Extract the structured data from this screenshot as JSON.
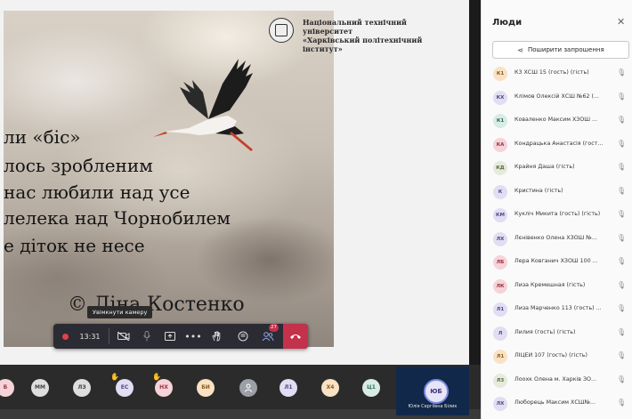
{
  "slide": {
    "poem_lines": [
      "ли «біс»",
      "лось зробленим",
      "нас любили над усе",
      "лелека над Чорнобилем",
      "е діток не несе"
    ],
    "author": "© Ліна Костенко",
    "university_line1": "Національний технічний університет",
    "university_line2": "«Харківський політехнічний інститут»"
  },
  "controls": {
    "timer": "13:31",
    "camera_tooltip": "Увімкнути камеру",
    "more_label": "•••",
    "participants_badge": "27"
  },
  "people_panel": {
    "title": "Люди",
    "share_label": "Поширити запрошення",
    "participants": [
      {
        "initials": "К1",
        "name": "К3 ХСШ 15 (гость) (гість)",
        "bg": "#f9e1c4",
        "fg": "#8a5a1c"
      },
      {
        "initials": "КХ",
        "name": "Клімов Олексій ХСШ №62 (...",
        "bg": "#e1ddf2",
        "fg": "#4f4a85"
      },
      {
        "initials": "К1",
        "name": "Коваленко Максим ХЗОШ ...",
        "bg": "#d7ece4",
        "fg": "#2f6d55"
      },
      {
        "initials": "КА",
        "name": "Кондрацька Анастасія (гост...",
        "bg": "#f5d3d8",
        "fg": "#9a3144"
      },
      {
        "initials": "КД",
        "name": "Крайня Даша (гість)",
        "bg": "#e6eadc",
        "fg": "#5a6a3a"
      },
      {
        "initials": "К",
        "name": "Кристина (гість)",
        "bg": "#e1ddf2",
        "fg": "#4f4a85"
      },
      {
        "initials": "КМ",
        "name": "Кукліч Микита (гость) (гість)",
        "bg": "#e1ddf2",
        "fg": "#4f4a85"
      },
      {
        "initials": "ЛХ",
        "name": "Лєнівенко Олена ХЗОШ №...",
        "bg": "#e1ddf2",
        "fg": "#4f4a85"
      },
      {
        "initials": "ЛБ",
        "name": "Лера Ковганич ХЗОШ 100 ...",
        "bg": "#f5d3d8",
        "fg": "#9a3144"
      },
      {
        "initials": "ЛК",
        "name": "Лиза Кремешная (гість)",
        "bg": "#f5d3d8",
        "fg": "#9a3144"
      },
      {
        "initials": "Л1",
        "name": "Лиза Марченко 113 (гость) ...",
        "bg": "#e1ddf2",
        "fg": "#4f4a85"
      },
      {
        "initials": "Л",
        "name": "Лилия (гость) (гість)",
        "bg": "#e1ddf2",
        "fg": "#4f4a85"
      },
      {
        "initials": "Л1",
        "name": "ЛІЦЕЙ 107 (гость) (гість)",
        "bg": "#f9e1c4",
        "fg": "#8a5a1c"
      },
      {
        "initials": "Л3",
        "name": "Лоохк Олена м. Харків ЗО...",
        "bg": "#e6eadc",
        "fg": "#5a6a3a"
      },
      {
        "initials": "ЛХ",
        "name": "Люборець Максим ХСШ№...",
        "bg": "#e1ddf2",
        "fg": "#4f4a85"
      }
    ]
  },
  "bottom_bar": {
    "avatars": [
      {
        "initials": "Б",
        "bg": "#f5d3d8",
        "fg": "#9a3144"
      },
      {
        "initials": "ММ",
        "bg": "#dedede",
        "fg": "#444444"
      },
      {
        "initials": "ЛЗ",
        "bg": "#dedede",
        "fg": "#444444"
      },
      {
        "initials": "ЕС",
        "bg": "#e1ddf2",
        "fg": "#4f4a85"
      },
      {
        "initials": "НХ",
        "bg": "#f5d3d8",
        "fg": "#9a3144"
      },
      {
        "initials": "БИ",
        "bg": "#f9e1c4",
        "fg": "#8a5a1c"
      },
      {
        "initials": "",
        "bg": "#9aa0a6",
        "fg": "#ffffff"
      },
      {
        "initials": "Л1",
        "bg": "#e1ddf2",
        "fg": "#4f4a85"
      },
      {
        "initials": "Х4",
        "bg": "#f9e1c4",
        "fg": "#8a5a1c"
      },
      {
        "initials": "Ц1",
        "bg": "#d7ece4",
        "fg": "#2f6d55"
      }
    ],
    "speaker": {
      "initials": "ЮБ",
      "name": "Юлія Сергіївна Білик"
    }
  }
}
